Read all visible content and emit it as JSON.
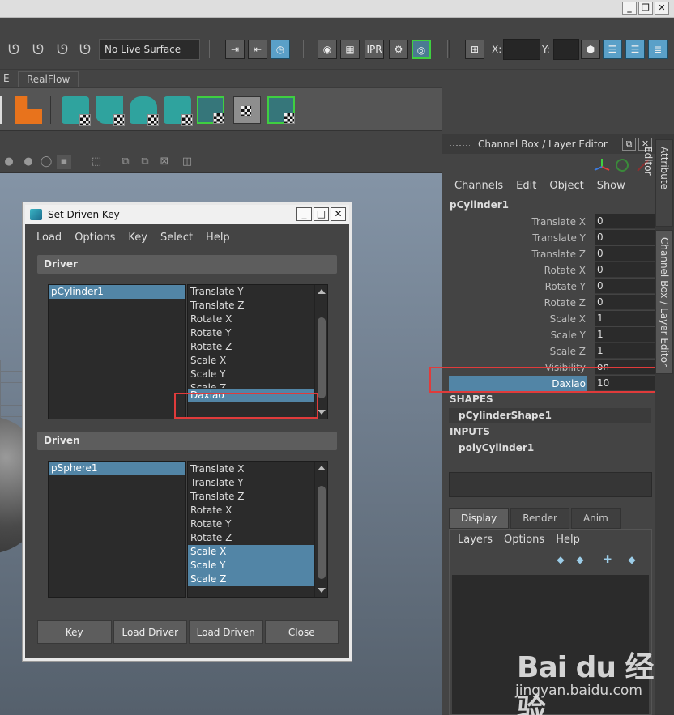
{
  "window": {
    "controls": [
      "_",
      "❐",
      "✕"
    ]
  },
  "status_line": {
    "live_surface": "No Live Surface",
    "x_label": "X:",
    "y_label": "Y:"
  },
  "shelf": {
    "tabs": [
      "E",
      "RealFlow"
    ]
  },
  "set_driven_key": {
    "title": "Set Driven Key",
    "menu": [
      "Load",
      "Options",
      "Key",
      "Select",
      "Help"
    ],
    "driver_label": "Driver",
    "driven_label": "Driven",
    "driver_objects": [
      "pCylinder1"
    ],
    "driver_attributes": [
      "Translate Y",
      "Translate Z",
      "Rotate X",
      "Rotate Y",
      "Rotate Z",
      "Scale X",
      "Scale Y",
      "Scale Z",
      "Daxiao"
    ],
    "driver_selected_attribute": "Daxiao",
    "driven_objects": [
      "pSphere1"
    ],
    "driven_attributes": [
      "Translate X",
      "Translate Y",
      "Translate Z",
      "Rotate X",
      "Rotate Y",
      "Rotate Z",
      "Scale X",
      "Scale Y",
      "Scale Z"
    ],
    "driven_selected_attributes": [
      "Scale X",
      "Scale Y",
      "Scale Z"
    ],
    "buttons": {
      "key": "Key",
      "load_driver": "Load Driver",
      "load_driven": "Load Driven",
      "close": "Close"
    }
  },
  "channel_box": {
    "title": "Channel Box / Layer Editor",
    "menu": [
      "Channels",
      "Edit",
      "Object",
      "Show"
    ],
    "object": "pCylinder1",
    "channels": [
      {
        "label": "Translate X",
        "value": "0"
      },
      {
        "label": "Translate Y",
        "value": "0"
      },
      {
        "label": "Translate Z",
        "value": "0"
      },
      {
        "label": "Rotate X",
        "value": "0"
      },
      {
        "label": "Rotate Y",
        "value": "0"
      },
      {
        "label": "Rotate Z",
        "value": "0"
      },
      {
        "label": "Scale X",
        "value": "1"
      },
      {
        "label": "Scale Y",
        "value": "1"
      },
      {
        "label": "Scale Z",
        "value": "1"
      },
      {
        "label": "Visibility",
        "value": "on"
      },
      {
        "label": "Daxiao",
        "value": "10"
      }
    ],
    "shapes_label": "SHAPES",
    "shape": "pCylinderShape1",
    "inputs_label": "INPUTS",
    "input": "polyCylinder1"
  },
  "layer_editor": {
    "tabs": [
      "Display",
      "Render",
      "Anim"
    ],
    "menu": [
      "Layers",
      "Options",
      "Help"
    ]
  },
  "side_tabs": [
    "Attribute Editor",
    "Channel Box / Layer Editor"
  ],
  "watermark": {
    "brand": "Bai du 经验",
    "url": "jingyan.baidu.com"
  },
  "colors": {
    "selection": "#5285a6",
    "highlight_box": "#e03b3b",
    "panel": "#444444"
  }
}
